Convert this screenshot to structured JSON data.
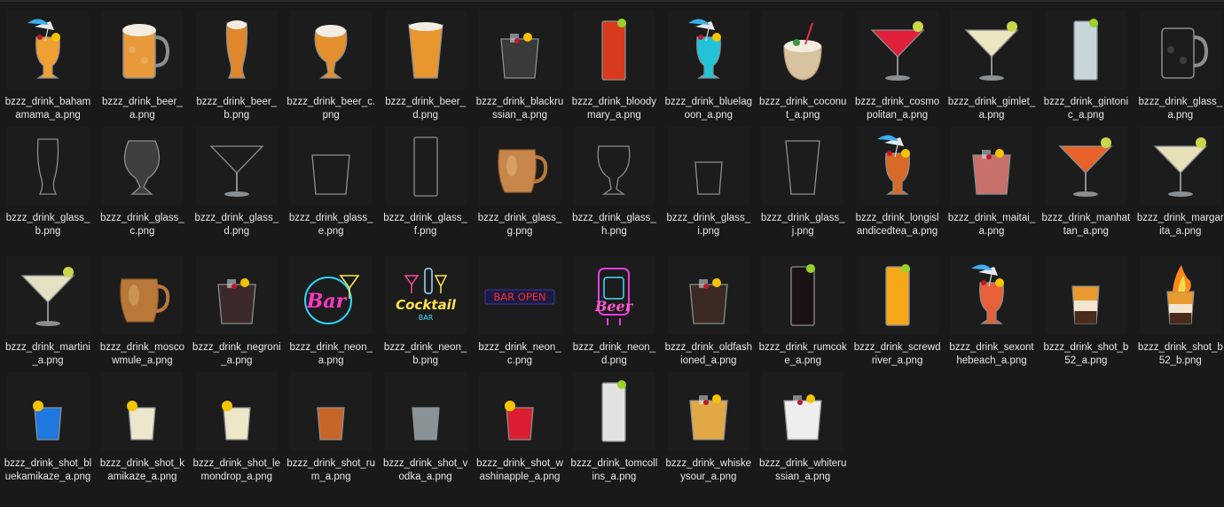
{
  "files": [
    {
      "label": "bzzz_drink_bahamamama_a.png",
      "icon": "cocktail-umbrella-icon",
      "liquid": "#f0a030"
    },
    {
      "label": "bzzz_drink_beer_a.png",
      "icon": "beer-mug-icon",
      "liquid": "#e89a3a"
    },
    {
      "label": "bzzz_drink_beer_b.png",
      "icon": "beer-pilsner-icon",
      "liquid": "#e0862b"
    },
    {
      "label": "bzzz_drink_beer_c.png",
      "icon": "beer-tulip-icon",
      "liquid": "#e5902f"
    },
    {
      "label": "bzzz_drink_beer_d.png",
      "icon": "beer-pint-icon",
      "liquid": "#e8962f"
    },
    {
      "label": "bzzz_drink_blackrussian_a.png",
      "icon": "rocks-glass-icon",
      "liquid": "#3a3a3a"
    },
    {
      "label": "bzzz_drink_bloodymary_a.png",
      "icon": "highball-glass-icon",
      "liquid": "#d83a1e"
    },
    {
      "label": "bzzz_drink_bluelagoon_a.png",
      "icon": "cocktail-umbrella-icon",
      "liquid": "#22c3d8"
    },
    {
      "label": "bzzz_drink_coconut_a.png",
      "icon": "coconut-drink-icon",
      "liquid": "#d8c2a0"
    },
    {
      "label": "bzzz_drink_cosmopolitan_a.png",
      "icon": "martini-glass-icon",
      "liquid": "#e0203a"
    },
    {
      "label": "bzzz_drink_gimlet_a.png",
      "icon": "martini-glass-icon",
      "liquid": "#ece6c0"
    },
    {
      "label": "bzzz_drink_gintonic_a.png",
      "icon": "highball-glass-icon",
      "liquid": "#c8d6d8"
    },
    {
      "label": "bzzz_drink_glass_a.png",
      "icon": "beer-mug-icon",
      "liquid": "none"
    },
    {
      "label": "bzzz_drink_glass_b.png",
      "icon": "beer-pilsner-icon",
      "liquid": "none"
    },
    {
      "label": "bzzz_drink_glass_c.png",
      "icon": "snifter-glass-icon",
      "liquid": "none"
    },
    {
      "label": "bzzz_drink_glass_d.png",
      "icon": "martini-glass-icon",
      "liquid": "none"
    },
    {
      "label": "bzzz_drink_glass_e.png",
      "icon": "rocks-glass-icon",
      "liquid": "none"
    },
    {
      "label": "bzzz_drink_glass_f.png",
      "icon": "highball-glass-icon",
      "liquid": "none"
    },
    {
      "label": "bzzz_drink_glass_g.png",
      "icon": "copper-mug-icon",
      "liquid": "#c8874a"
    },
    {
      "label": "bzzz_drink_glass_h.png",
      "icon": "beer-tulip-icon",
      "liquid": "none"
    },
    {
      "label": "bzzz_drink_glass_i.png",
      "icon": "shot-glass-icon",
      "liquid": "none"
    },
    {
      "label": "bzzz_drink_glass_j.png",
      "icon": "beer-pint-icon",
      "liquid": "none"
    },
    {
      "label": "bzzz_drink_longislandicedtea_a.png",
      "icon": "cocktail-umbrella-icon",
      "liquid": "#d86a28"
    },
    {
      "label": "bzzz_drink_maitai_a.png",
      "icon": "rocks-glass-icon",
      "liquid": "#c8706a"
    },
    {
      "label": "bzzz_drink_manhattan_a.png",
      "icon": "martini-glass-icon",
      "liquid": "#e8602a"
    },
    {
      "label": "bzzz_drink_margarita_a.png",
      "icon": "martini-glass-icon",
      "liquid": "#e6dfb8"
    },
    {
      "label": "bzzz_drink_martini_a.png",
      "icon": "martini-glass-icon",
      "liquid": "#e3e0c4"
    },
    {
      "label": "bzzz_drink_moscowmule_a.png",
      "icon": "copper-mug-icon",
      "liquid": "#b87838"
    },
    {
      "label": "bzzz_drink_negroni_a.png",
      "icon": "rocks-glass-icon",
      "liquid": "#3c2a2a"
    },
    {
      "label": "bzzz_drink_neon_a.png",
      "icon": "neon-bar-sign-icon",
      "liquid": "#ff38c8"
    },
    {
      "label": "bzzz_drink_neon_b.png",
      "icon": "neon-cocktail-sign-icon",
      "liquid": "#ffe24a"
    },
    {
      "label": "bzzz_drink_neon_c.png",
      "icon": "neon-bar-open-sign-icon",
      "liquid": "#ff2a2a"
    },
    {
      "label": "bzzz_drink_neon_d.png",
      "icon": "neon-beer-sign-icon",
      "liquid": "#e040e0"
    },
    {
      "label": "bzzz_drink_oldfashioned_a.png",
      "icon": "rocks-glass-icon",
      "liquid": "#3a2a22"
    },
    {
      "label": "bzzz_drink_rumcoke_a.png",
      "icon": "highball-glass-icon",
      "liquid": "#1a1214"
    },
    {
      "label": "bzzz_drink_screwdriver_a.png",
      "icon": "highball-glass-icon",
      "liquid": "#f5a818"
    },
    {
      "label": "bzzz_drink_sexonthebeach_a.png",
      "icon": "cocktail-umbrella-icon",
      "liquid": "#e8603a"
    },
    {
      "label": "bzzz_drink_shot_b52_a.png",
      "icon": "layered-shot-icon",
      "liquid": "#e89a30"
    },
    {
      "label": "bzzz_drink_shot_b52_b.png",
      "icon": "flaming-shot-icon",
      "liquid": "#e89a30"
    },
    {
      "label": "bzzz_drink_shot_bluekamikaze_a.png",
      "icon": "shot-glass-icon",
      "liquid": "#1e78e0"
    },
    {
      "label": "bzzz_drink_shot_kamikaze_a.png",
      "icon": "shot-glass-icon",
      "liquid": "#ece6cc"
    },
    {
      "label": "bzzz_drink_shot_lemondrop_a.png",
      "icon": "shot-glass-icon",
      "liquid": "#ede7c8"
    },
    {
      "label": "bzzz_drink_shot_rum_a.png",
      "icon": "shot-glass-icon",
      "liquid": "#c8662a"
    },
    {
      "label": "bzzz_drink_shot_vodka_a.png",
      "icon": "shot-glass-icon",
      "liquid": "#8a9296"
    },
    {
      "label": "bzzz_drink_shot_washinapple_a.png",
      "icon": "shot-glass-icon",
      "liquid": "#d81e30"
    },
    {
      "label": "bzzz_drink_tomcollins_a.png",
      "icon": "highball-glass-icon",
      "liquid": "#e2e2e2"
    },
    {
      "label": "bzzz_drink_whiskeysour_a.png",
      "icon": "rocks-glass-icon",
      "liquid": "#e2a846"
    },
    {
      "label": "bzzz_drink_whiterussian_a.png",
      "icon": "rocks-glass-icon",
      "liquid": "#eeeeee"
    }
  ],
  "neon": {
    "bar": "Bar",
    "cocktail": "Cocktail",
    "cocktail_sub": "BAR",
    "bar_open": "BAR OPEN",
    "beer": "Beer"
  }
}
